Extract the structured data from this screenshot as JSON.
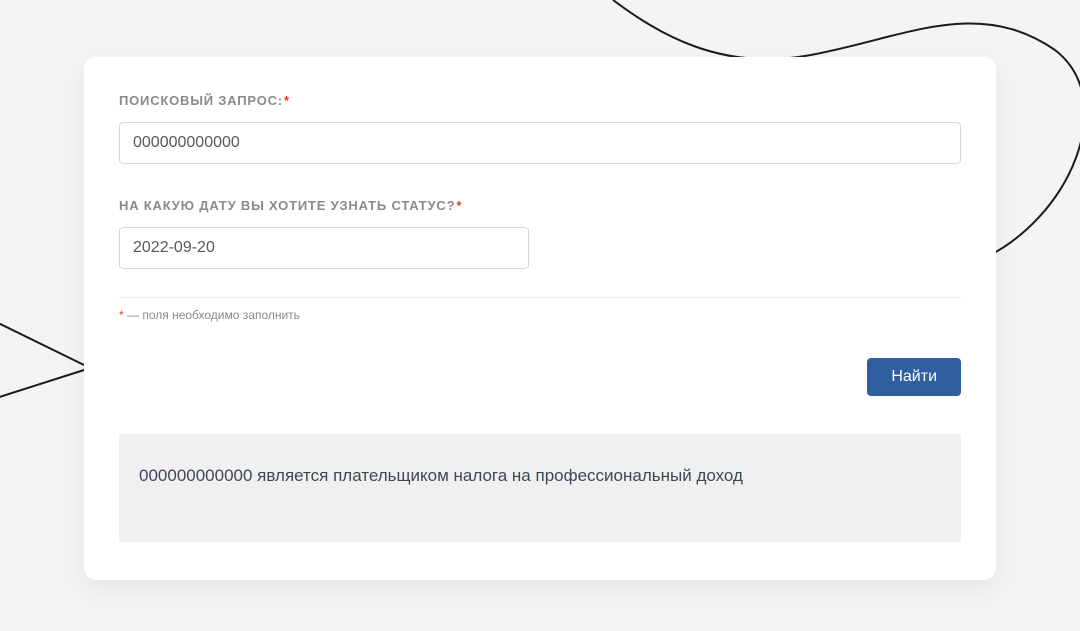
{
  "form": {
    "query_label": "Поисковый запрос:",
    "query_value": "000000000000",
    "date_label": "На какую дату Вы хотите узнать статус?",
    "date_value": "2022-09-20",
    "hint_text": " — поля необходимо заполнить",
    "submit_label": "Найти"
  },
  "result": {
    "text": "000000000000 является плательщиком налога на профессиональный доход"
  }
}
